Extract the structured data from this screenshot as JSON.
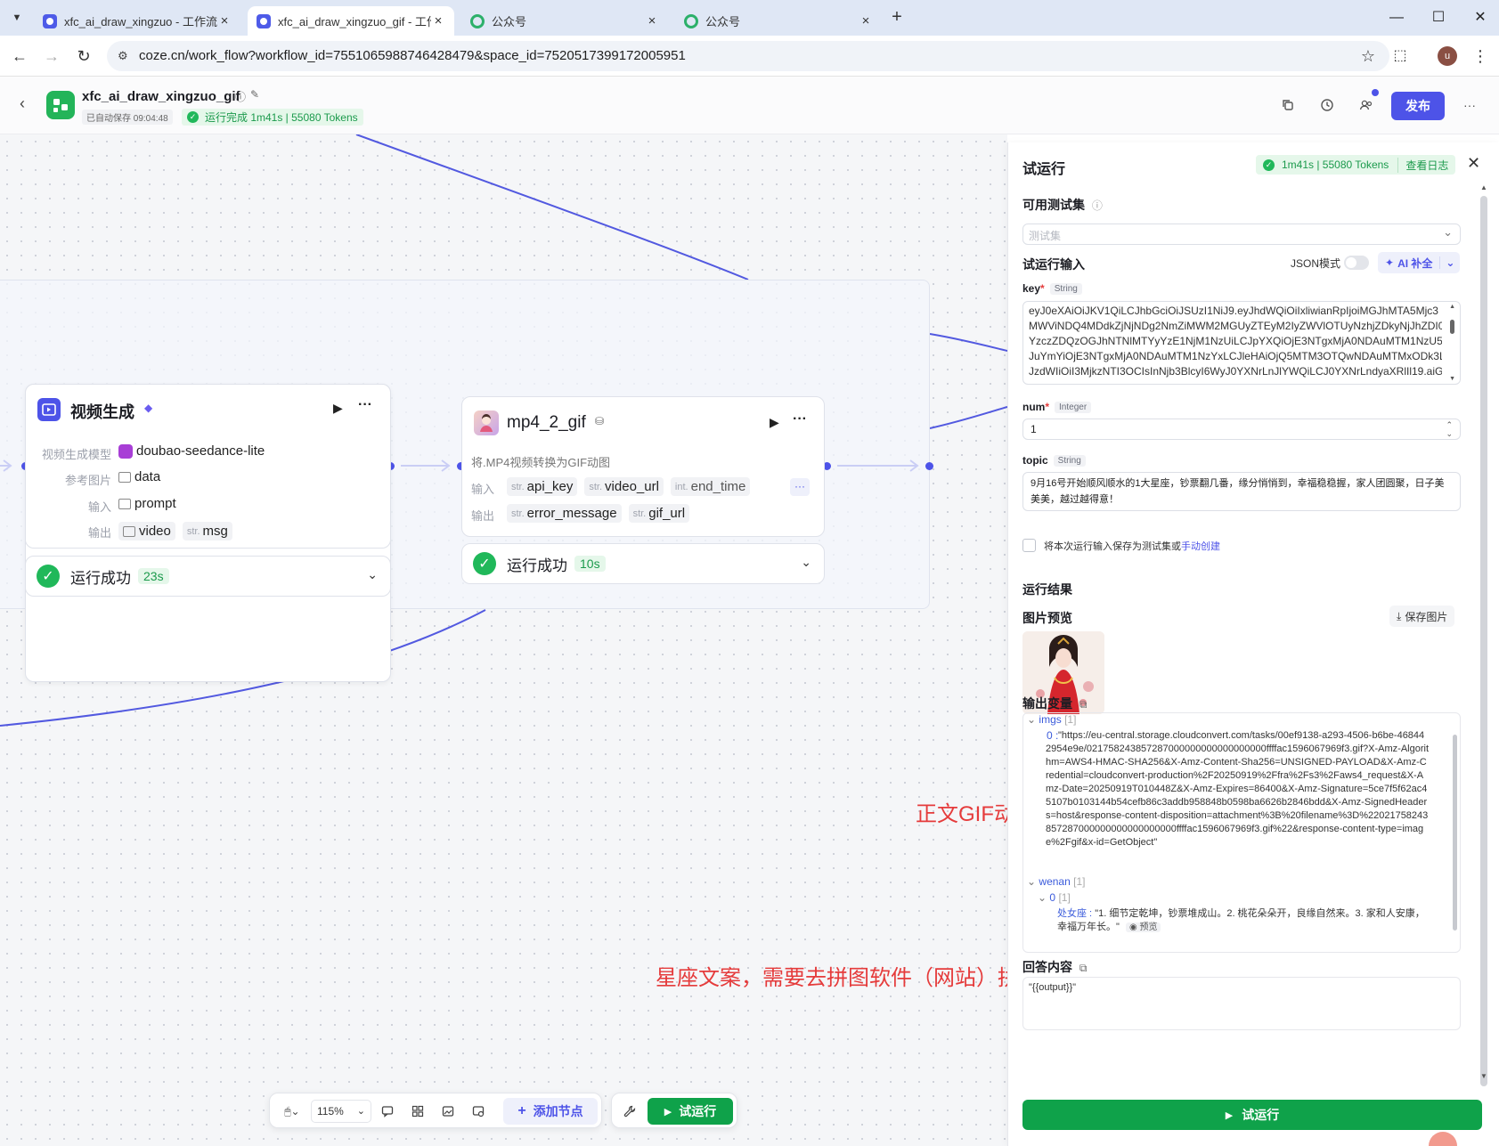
{
  "browser": {
    "tabs": [
      {
        "title": "xfc_ai_draw_xingzuo - 工作流"
      },
      {
        "title": "xfc_ai_draw_xingzuo_gif - 工作流"
      },
      {
        "title": "公众号"
      },
      {
        "title": "公众号"
      }
    ],
    "new_tab": "+",
    "url": "coze.cn/work_flow?workflow_id=7551065988746428479&space_id=7520517399172005951",
    "avatar_letter": "u"
  },
  "header": {
    "workflow_name": "xfc_ai_draw_xingzuo_gif",
    "autosave": "已自动保存 09:04:48",
    "run_status": "运行完成 1m41s | 55080 Tokens",
    "publish": "发布"
  },
  "nodes": {
    "video_gen": {
      "title": "视频生成",
      "rows": [
        {
          "label": "视频生成模型",
          "value": "doubao-seedance-lite"
        },
        {
          "label": "参考图片",
          "value": "data"
        },
        {
          "label": "输入",
          "value": "prompt"
        },
        {
          "label": "输出",
          "values": [
            "video",
            "msg"
          ],
          "types": [
            "",
            "str."
          ]
        }
      ],
      "status": "运行成功",
      "duration": "23s"
    },
    "mp4_gif": {
      "title": "mp4_2_gif",
      "desc": "将.MP4视频转换为GIF动图",
      "input_label": "输入",
      "inputs": [
        {
          "type": "str.",
          "name": "api_key"
        },
        {
          "type": "str.",
          "name": "video_url"
        },
        {
          "type": "int.",
          "name": "end_time"
        }
      ],
      "output_label": "输出",
      "outputs": [
        {
          "type": "str.",
          "name": "error_message"
        },
        {
          "type": "str.",
          "name": "gif_url"
        }
      ],
      "more": "···",
      "status": "运行成功",
      "duration": "10s"
    }
  },
  "annotations": {
    "gif_note": "正文GIF动图",
    "copy_note": "星座文案，需要去拼图软件（网站）拼接"
  },
  "toolbar": {
    "zoom": "115%",
    "add_node": "添加节点",
    "test_run": "试运行"
  },
  "panel": {
    "title": "试运行",
    "summary": "1m41s | 55080 Tokens",
    "view_log": "查看日志",
    "testset_label": "可用测试集",
    "testset_placeholder": "测试集",
    "input_label": "试运行输入",
    "json_mode": "JSON模式",
    "ai_fill": "AI 补全",
    "key": {
      "name": "key",
      "type": "String",
      "lines": [
        "eyJ0eXAiOiJKV1QiLCJhbGciOiJSUzI1NiJ9.eyJhdWQiOiIxliwianRpIjoiMGJhMTA5Mjc3",
        "MWViNDQ4MDdkZjNjNDg2NmZiMWM2MGUyZTEyM2IyZWVlOTUyNzhjZDkyNjJhZDI0",
        "YzczZDQzOGJhNTNlMTYyYzE1NjM1NzUiLCJpYXQiOjE3NTgxMjA0NDAuMTM1NzU5LC",
        "JuYmYiOjE3NTgxMjA0NDAuMTM1NzYxLCJleHAiOjQ5MTM3OTQwNDAuMTMxODk3LC",
        "JzdWIiOiI3MjkzNTI3OCIsInNjb3BlcyI6WyJ0YXNrLnJlYWQiLCJ0YXNrLndyaXRlIl19.aiG"
      ]
    },
    "num": {
      "name": "num",
      "type": "Integer",
      "value": "1"
    },
    "topic": {
      "name": "topic",
      "type": "String",
      "value": "9月16号开始顺风顺水的1大星座，钞票翻几番，缘分悄悄到，幸福稳稳握，家人团圆聚，日子美美美，越过越得意！"
    },
    "save_testset": "将本次运行输入保存为测试集或",
    "manual_create": "手动创建",
    "result_label": "运行结果",
    "preview_label": "图片预览",
    "save_image": "保存图片",
    "output_vars": "输出变量",
    "imgs_key": "imgs",
    "imgs_count": "[1]",
    "imgs_index": "0 :",
    "imgs_value": "\"https://eu-central.storage.cloudconvert.com/tasks/00ef9138-a293-4506-b6be-468442954e9e/021758243857287000000000000000000ffffac1596067969f3.gif?X-Amz-Algorithm=AWS4-HMAC-SHA256&X-Amz-Content-Sha256=UNSIGNED-PAYLOAD&X-Amz-Credential=cloudconvert-production%2F20250919%2Ffra%2Fs3%2Faws4_request&X-Amz-Date=20250919T010448Z&X-Amz-Expires=86400&X-Amz-Signature=5ce7f5f62ac45107b0103144b54cefb86c3addb958848b0598ba6626b2846bdd&X-Amz-SignedHeaders=host&response-content-disposition=attachment%3B%20filename%3D%22021758243857287000000000000000000ffffac1596067969f3.gif%22&response-content-type=image%2Fgif&x-id=GetObject\"",
    "wenan_key": "wenan",
    "wenan_count": "[1]",
    "wenan_index": "0",
    "wenan_index_count": "[1]",
    "wenan_sub_key": "处女座 :",
    "wenan_value": "\"1. 细节定乾坤，钞票堆成山。2. 桃花朵朵开，良缘自然来。3. 家和人安康，幸福万年长。\"",
    "preview_btn": "预览",
    "answer_label": "回答内容",
    "answer_value": "\"{{output}}\"",
    "run_button": "试运行"
  },
  "colors": {
    "accent": "#4d53e8",
    "success": "#20b85a",
    "run_green": "#0fa24a",
    "annotation_red": "#e53b3b"
  }
}
